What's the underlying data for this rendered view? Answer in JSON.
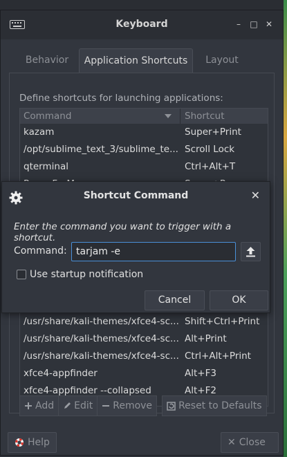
{
  "window": {
    "title": "Keyboard",
    "controls": {
      "minimize": "–",
      "maximize": "□",
      "close": "✕"
    }
  },
  "tabs": [
    {
      "label": "Behavior",
      "active": false
    },
    {
      "label": "Application Shortcuts",
      "active": true
    },
    {
      "label": "Layout",
      "active": false
    }
  ],
  "shortcuts": {
    "description": "Define shortcuts for launching applications:",
    "columns": {
      "command": "Command",
      "shortcut": "Shortcut"
    },
    "rows_top": [
      {
        "command": "kazam",
        "shortcut": "Super+Print"
      },
      {
        "command": "/opt/sublime_text_3/sublime_te...",
        "shortcut": "Scroll Lock"
      },
      {
        "command": "qterminal",
        "shortcut": "Ctrl+Alt+T"
      },
      {
        "command": "ReconForMe",
        "shortcut": "Super+R"
      }
    ],
    "rows_bottom": [
      {
        "command": "/usr/share/kali-themes/xfce4-sc...",
        "shortcut": "Shift+Ctrl+Print"
      },
      {
        "command": "/usr/share/kali-themes/xfce4-sc...",
        "shortcut": "Alt+Print"
      },
      {
        "command": "/usr/share/kali-themes/xfce4-sc...",
        "shortcut": "Ctrl+Alt+Print"
      },
      {
        "command": "xfce4-appfinder",
        "shortcut": "Alt+F3"
      },
      {
        "command": "xfce4-appfinder --collapsed",
        "shortcut": "Alt+F2"
      }
    ],
    "toolbar": {
      "add": "Add",
      "edit": "Edit",
      "remove": "Remove",
      "reset": "Reset to Defaults"
    }
  },
  "footer": {
    "help": "Help",
    "close": "Close"
  },
  "dialog": {
    "title": "Shortcut Command",
    "close_glyph": "✕",
    "prompt": "Enter the command you want to trigger with a shortcut.",
    "command_label": "Command:",
    "command_value": "tarjam -e",
    "startup_notification_label": "Use startup notification",
    "startup_notification_checked": false,
    "cancel": "Cancel",
    "ok": "OK"
  },
  "colors": {
    "window_bg": "#32363e",
    "titlebar_bg": "#2b2e34",
    "input_focus": "#4a90d9",
    "text": "#e0e0e0",
    "muted_text": "#8e9197"
  }
}
